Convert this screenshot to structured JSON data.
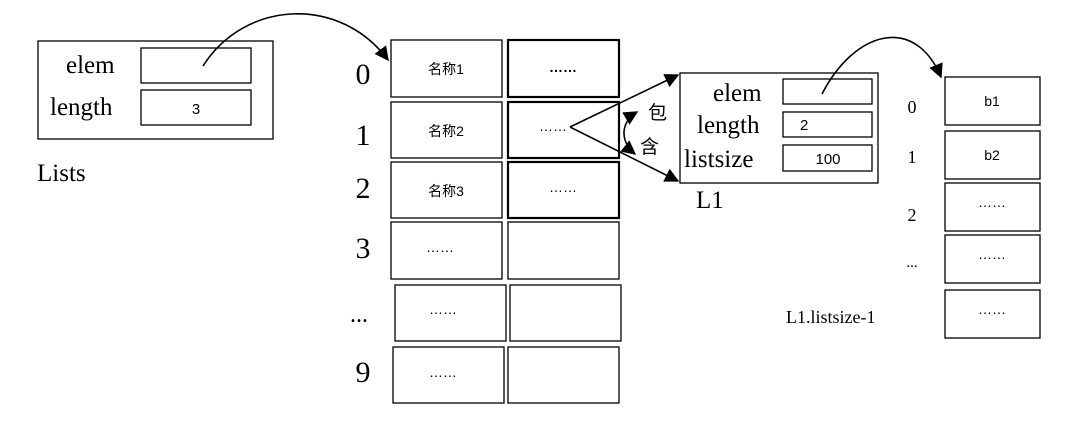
{
  "lists_struct": {
    "elem_label": "elem",
    "length_label": "length",
    "length_value": "3",
    "name": "Lists"
  },
  "array": {
    "indices": [
      "0",
      "1",
      "2",
      "3",
      "...",
      "9"
    ],
    "names": [
      "名称1",
      "名称2",
      "名称3",
      "……",
      "……",
      "……"
    ],
    "ptrs": [
      "……",
      "……",
      "……",
      "",
      "",
      ""
    ]
  },
  "contains_label": [
    "包",
    "含"
  ],
  "l1_struct": {
    "elem_label": "elem",
    "length_label": "length",
    "length_value": "2",
    "listsize_label": "listsize",
    "listsize_value": "100",
    "name": "L1"
  },
  "l1_array": {
    "indices": [
      "0",
      "1",
      "2",
      "...",
      "L1.listsize-1"
    ],
    "values": [
      "b1",
      "b2",
      "……",
      "……",
      "……"
    ]
  }
}
